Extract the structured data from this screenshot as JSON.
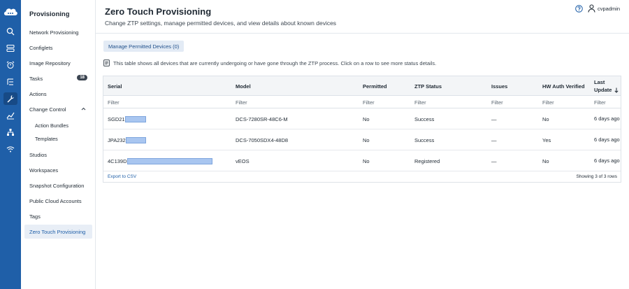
{
  "rail": {
    "items": [
      {
        "icon": "search-icon"
      },
      {
        "icon": "inventory-icon"
      },
      {
        "icon": "events-alarm-icon"
      },
      {
        "icon": "topology-list-icon"
      },
      {
        "icon": "provisioning-wrench-icon",
        "active": true
      },
      {
        "icon": "metrics-chart-icon"
      },
      {
        "icon": "network-icon"
      },
      {
        "icon": "wifi-icon"
      }
    ]
  },
  "sidebar": {
    "title": "Provisioning",
    "items": [
      {
        "label": "Network Provisioning"
      },
      {
        "label": "Configlets"
      },
      {
        "label": "Image Repository"
      },
      {
        "label": "Tasks",
        "badge": "18"
      },
      {
        "label": "Actions"
      },
      {
        "label": "Change Control",
        "expanded": true
      },
      {
        "label": "Action Bundles",
        "sub": true
      },
      {
        "label": "Templates",
        "sub": true
      },
      {
        "label": "Studios"
      },
      {
        "label": "Workspaces"
      },
      {
        "label": "Snapshot Configuration"
      },
      {
        "label": "Public Cloud Accounts"
      },
      {
        "label": "Tags"
      },
      {
        "label": "Zero Touch Provisioning",
        "active": true
      }
    ]
  },
  "header": {
    "title": "Zero Touch Provisioning",
    "subtitle": "Change ZTP settings, manage permitted devices, and view details about known devices",
    "user": "cvpadmin"
  },
  "main": {
    "manage_button": "Manage Permitted Devices (0)",
    "info_text": "This table shows all devices that are currently undergoing or have gone through the ZTP process. Click on a row to see more status details.",
    "table": {
      "columns": [
        "Serial",
        "Model",
        "Permitted",
        "ZTP Status",
        "Issues",
        "HW Auth Verified",
        "Last Update"
      ],
      "filter_placeholder": "Filter",
      "rows": [
        {
          "serial": "SGD21",
          "model": "DCS-7280SR-48C6-M",
          "permitted": "No",
          "ztp_status": "Success",
          "issues": "—",
          "hw_auth": "No",
          "last_update": "6 days ago"
        },
        {
          "serial": "JPA232",
          "model": "DCS-7050SDX4-48D8",
          "permitted": "No",
          "ztp_status": "Success",
          "issues": "—",
          "hw_auth": "Yes",
          "last_update": "6 days ago"
        },
        {
          "serial": "4C139D",
          "model": "vEOS",
          "permitted": "No",
          "ztp_status": "Registered",
          "issues": "—",
          "hw_auth": "No",
          "last_update": "6 days ago"
        }
      ],
      "export_label": "Export to CSV",
      "showing_text": "Showing 3 of 3 rows"
    }
  },
  "colors": {
    "rail_bg": "#1f5fa8",
    "accent": "#1f5fa8",
    "active_item_bg": "#e8eef6",
    "redaction": "#a9c6f0"
  }
}
